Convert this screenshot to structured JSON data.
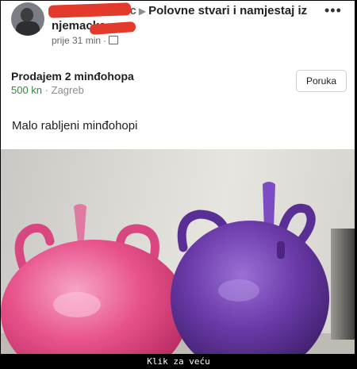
{
  "post": {
    "group_lead": "vic",
    "group_name": "Polovne stvari i namjestaj iz",
    "poster_name": "njemacke",
    "time": "prije 31 min",
    "separator": "·",
    "more_label": "•••"
  },
  "listing": {
    "title": "Prodajem 2 minđohopa",
    "price": "500 kn",
    "location_sep": "·",
    "location": "Zagreb",
    "message_button": "Poruka"
  },
  "body": {
    "text": "Malo rabljeni minđohopi"
  },
  "footer": {
    "link": "Klik za veću"
  },
  "photo": {
    "ball_left_color": "#e8528a",
    "ball_right_color": "#6a3aa8"
  }
}
